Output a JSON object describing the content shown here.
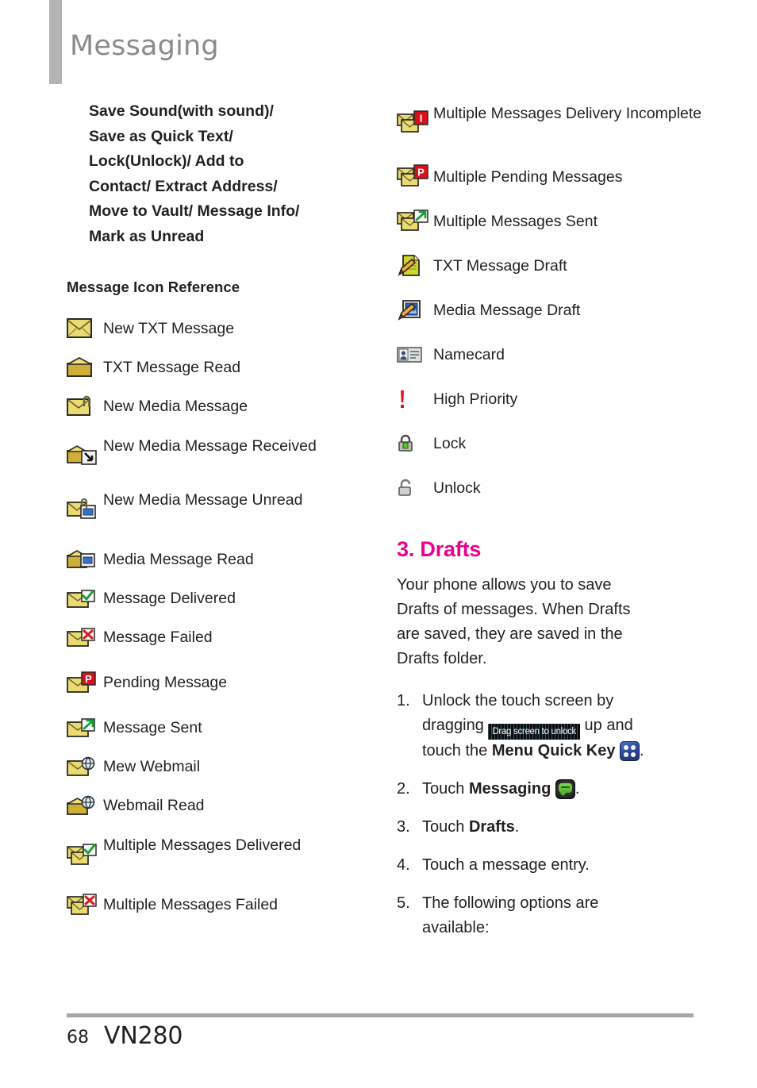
{
  "header": {
    "title": "Messaging"
  },
  "left_column": {
    "intro_lines": [
      "Save Sound(with sound)/",
      "Save as Quick Text/",
      "Lock(Unlock)/ Add to",
      "Contact/ Extract Address/",
      "Move to Vault/ Message Info/",
      "Mark as Unread"
    ],
    "section_heading": "Message Icon Reference",
    "icon_items": [
      {
        "icon": "envelope-closed-icon",
        "label": "New TXT Message"
      },
      {
        "icon": "envelope-open-icon",
        "label": "TXT Message Read"
      },
      {
        "icon": "envelope-paperclip-icon",
        "label": "New Media Message"
      },
      {
        "icon": "envelope-arrow-in-icon",
        "label": "New Media Message Received"
      },
      {
        "icon": "envelope-unread-media-icon",
        "label": "New Media Message Unread"
      },
      {
        "icon": "envelope-open-media-icon",
        "label": "Media Message Read"
      },
      {
        "icon": "envelope-check-icon",
        "label": "Message Delivered"
      },
      {
        "icon": "envelope-x-icon",
        "label": "Message Failed"
      },
      {
        "icon": "envelope-p-icon",
        "label": "Pending Message"
      },
      {
        "icon": "envelope-arrow-out-icon",
        "label": "Message Sent"
      },
      {
        "icon": "envelope-globe-icon",
        "label": "Mew Webmail"
      },
      {
        "icon": "envelope-open-globe-icon",
        "label": "Webmail Read"
      },
      {
        "icon": "multi-envelope-check-icon",
        "label": "Multiple Messages Delivered"
      },
      {
        "icon": "multi-envelope-x-icon",
        "label": "Multiple Messages Failed"
      }
    ]
  },
  "right_column": {
    "icon_items": [
      {
        "icon": "multi-envelope-i-icon",
        "label": "Multiple Messages Delivery Incomplete"
      },
      {
        "icon": "multi-envelope-p-icon",
        "label": "Multiple Pending Messages"
      },
      {
        "icon": "multi-envelope-arrow-icon",
        "label": "Multiple Messages Sent"
      },
      {
        "icon": "draft-text-icon",
        "label": "TXT Message Draft"
      },
      {
        "icon": "draft-media-icon",
        "label": "Media Message Draft"
      },
      {
        "icon": "namecard-icon",
        "label": "Namecard"
      },
      {
        "icon": "exclamation-icon",
        "label": "High Priority"
      },
      {
        "icon": "lock-closed-icon",
        "label": "Lock"
      },
      {
        "icon": "lock-open-icon",
        "label": "Unlock"
      }
    ],
    "drafts": {
      "heading": "3. Drafts",
      "accent_color": "#ec008c",
      "body_lines": [
        "Your phone allows you to save",
        "Drafts of messages. When Drafts",
        "are saved, they are saved in the",
        "Drafts folder."
      ],
      "steps": [
        {
          "num": "1.",
          "line1": "Unlock the touch screen by",
          "line2_pre": "dragging",
          "unlock_badge": "Drag screen to unlock",
          "line2_post": "up and",
          "line3_pre": "touch the",
          "line3_bold": "Menu Quick Key",
          "line3_post": "."
        },
        {
          "num": "2.",
          "pre": "Touch",
          "bold": "Messaging",
          "post": "."
        },
        {
          "num": "3.",
          "pre": "Touch",
          "bold": "Drafts",
          "post": "."
        },
        {
          "num": "4.",
          "pre": "Touch a message entry.",
          "bold": "",
          "post": ""
        },
        {
          "num": "5.",
          "line1": "The following options are",
          "line2": "available:"
        }
      ]
    }
  },
  "footer": {
    "page_number": "68",
    "model": "VN280"
  }
}
